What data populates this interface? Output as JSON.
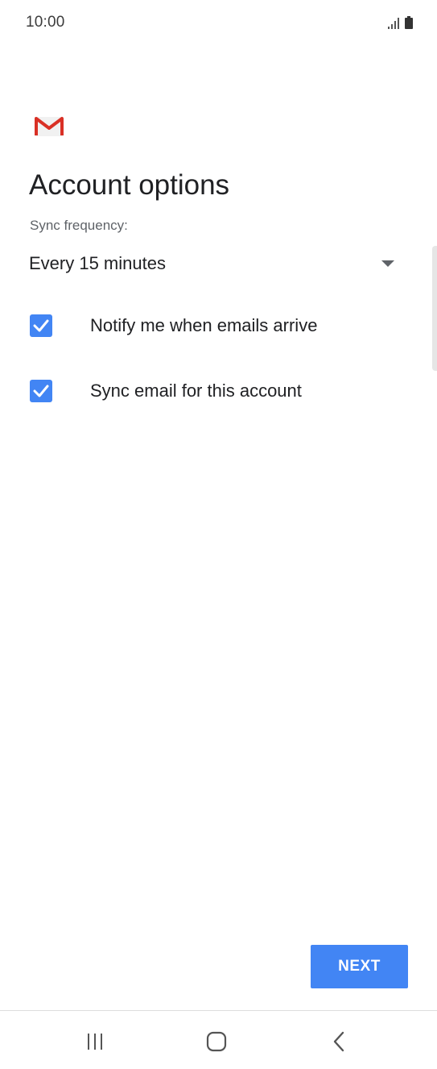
{
  "status_bar": {
    "time": "10:00",
    "icons": [
      "signal-icon",
      "battery-icon"
    ]
  },
  "app": {
    "logo": "gmail-logo"
  },
  "page": {
    "title": "Account options",
    "sync_label": "Sync frequency:",
    "sync_value": "Every 15 minutes",
    "options": [
      {
        "label": "Notify me when emails arrive",
        "checked": true
      },
      {
        "label": "Sync email for this account",
        "checked": true
      }
    ],
    "next_label": "NEXT"
  },
  "nav_bar": {
    "buttons": [
      "recents-icon",
      "home-icon",
      "back-icon"
    ]
  },
  "colors": {
    "accent": "#4285f4",
    "gmail_red": "#d93025"
  }
}
